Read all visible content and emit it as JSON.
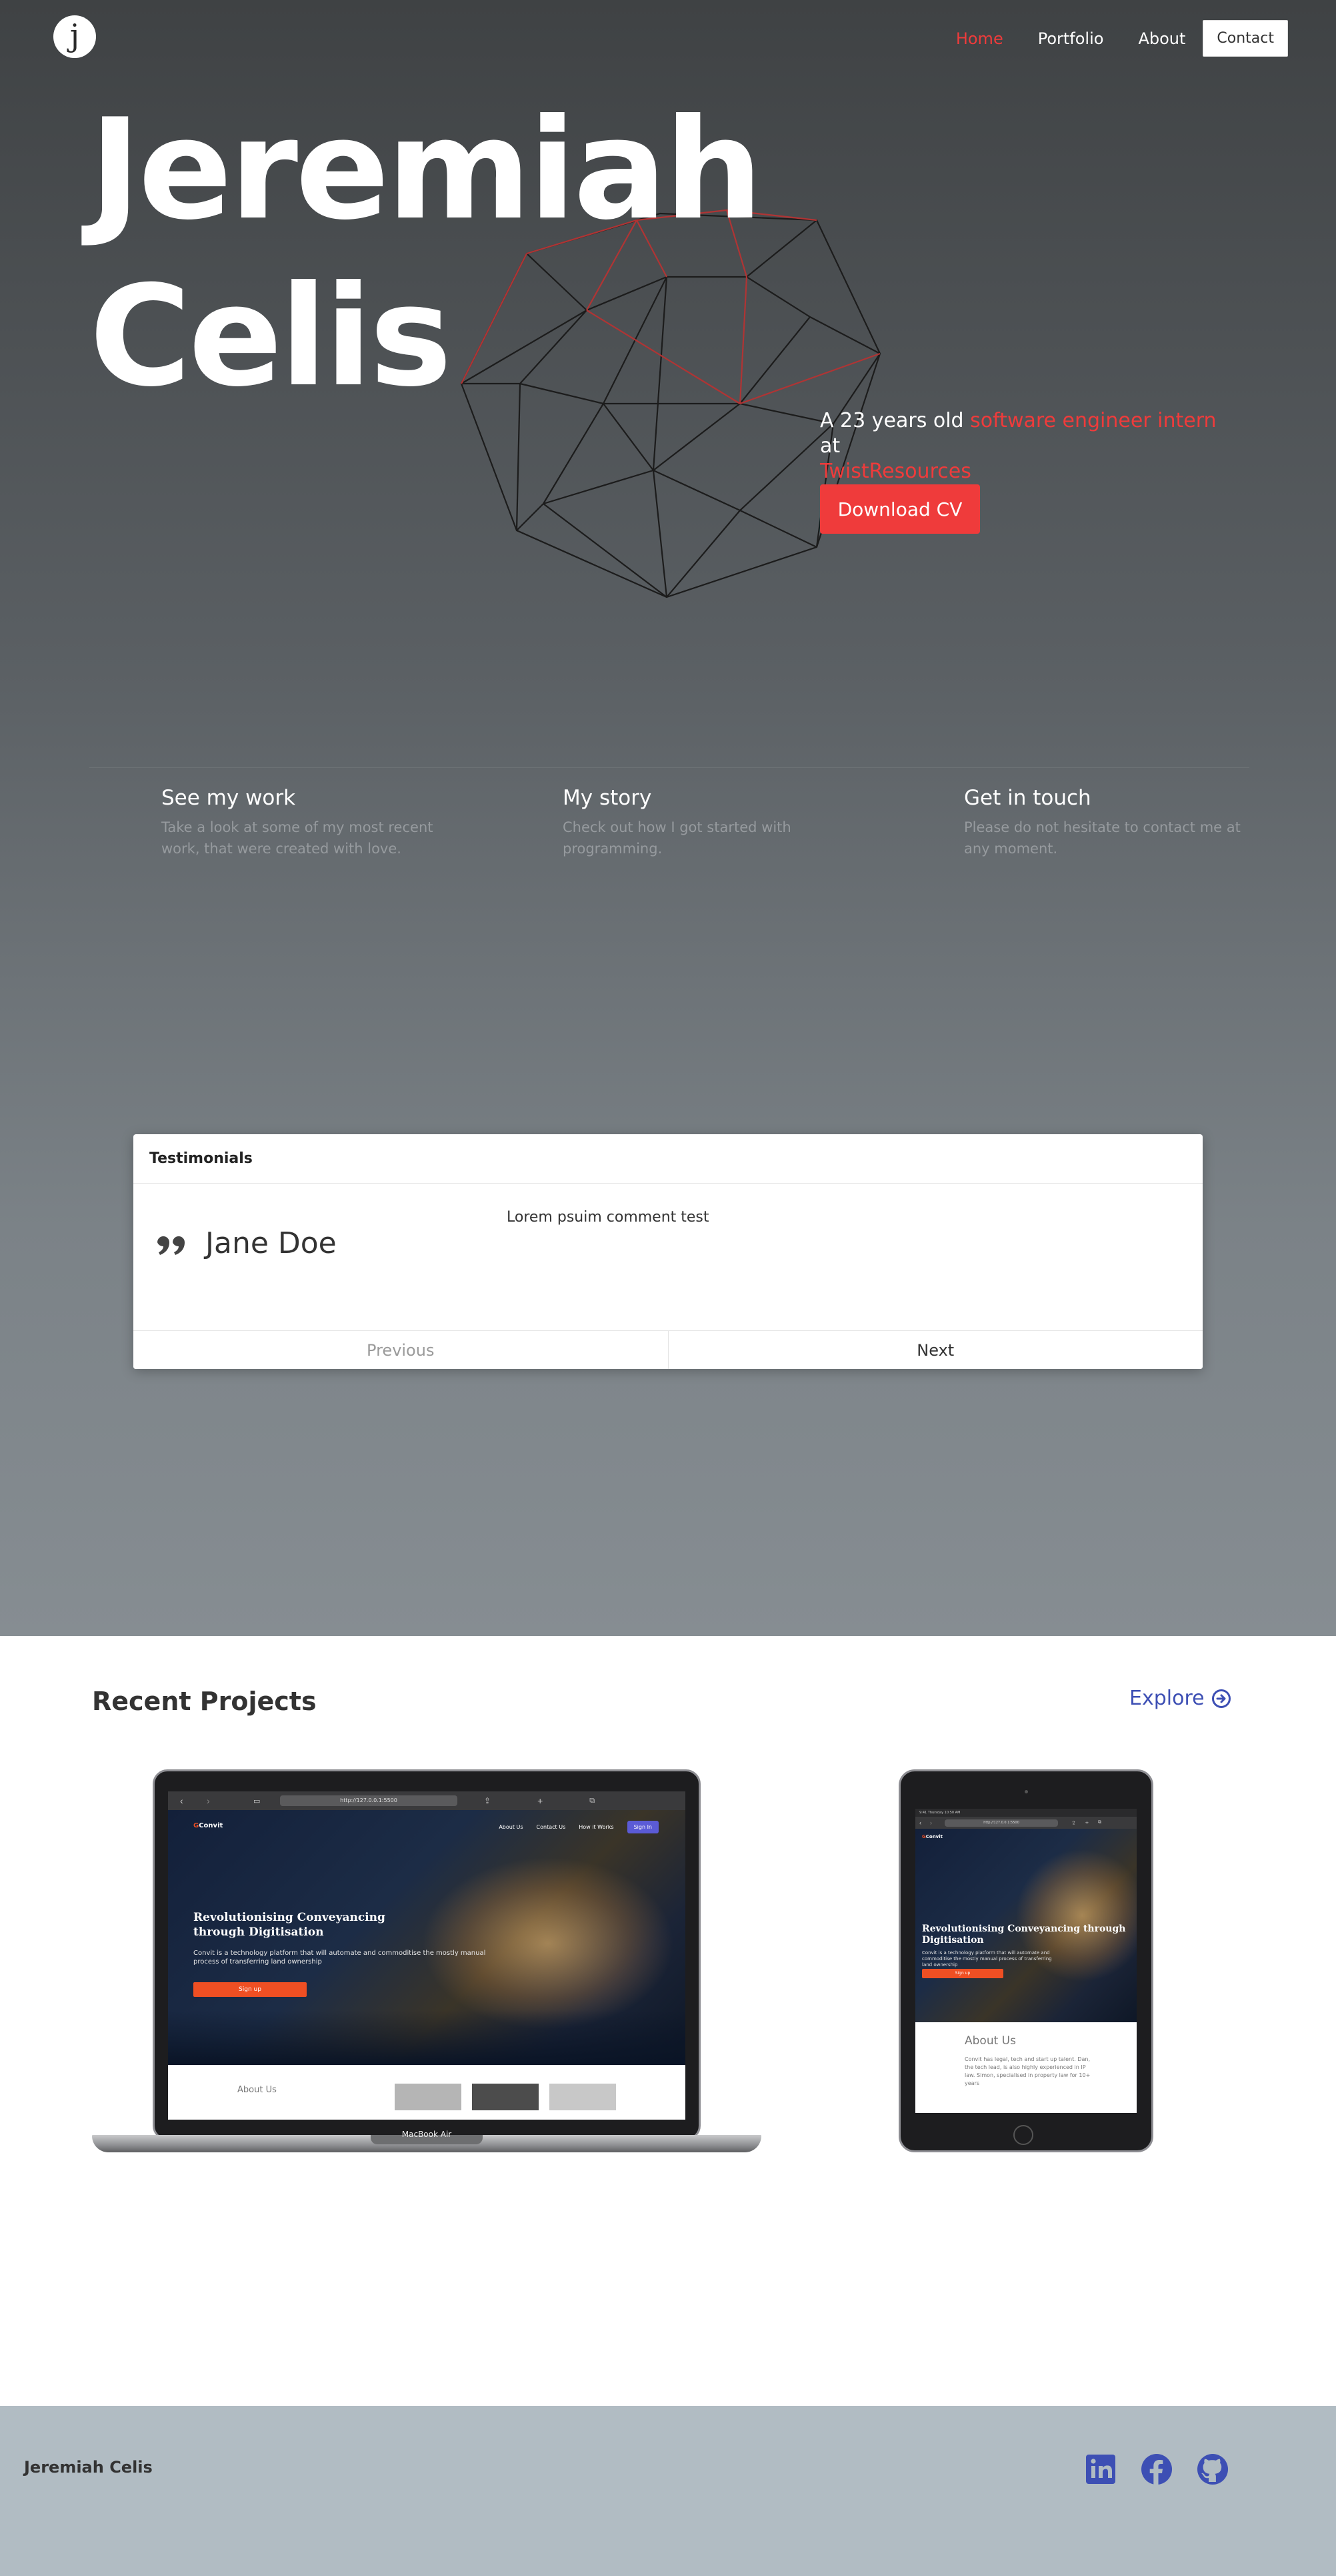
{
  "brand": {
    "logo_letter": "j"
  },
  "nav": {
    "home": "Home",
    "portfolio": "Portfolio",
    "about": "About",
    "contact": "Contact"
  },
  "hero": {
    "name_line1": "Jeremiah",
    "name_line2": "Celis",
    "tagline_prefix": "A 23 years old",
    "tagline_role": "software engineer intern",
    "tagline_at": "at",
    "tagline_company": "TwistResources",
    "cv_button": "Download CV"
  },
  "features": [
    {
      "title": "See my work",
      "text": "Take a look at some of my most recent work, that were created with love."
    },
    {
      "title": "My story",
      "text": "Check out how I got started with programming."
    },
    {
      "title": "Get in touch",
      "text": "Please do not hesitate to contact me at any moment."
    }
  ],
  "testimonials": {
    "header": "Testimonials",
    "name": "Jane Doe",
    "comment": "Lorem psuim comment test",
    "previous": "Previous",
    "next": "Next"
  },
  "projects": {
    "title": "Recent Projects",
    "explore": "Explore",
    "laptop_label": "MacBook Air",
    "laptop_url": "http://127.0.0.1:5500",
    "tablet_url": "http://127.0.0.1:5500",
    "tablet_status": "9:41 Thursday 10:50 AM",
    "site": {
      "logo_mark": "G",
      "logo_text": "Convit",
      "nav_about": "About Us",
      "nav_contact": "Contact Us",
      "nav_how": "How it Works",
      "nav_signin": "Sign In",
      "heading": "Revolutionising Conveyancing through Digitisation",
      "text": "Convit is a technology platform that will automate and commoditise the mostly manual process of transferring land ownership",
      "signup": "Sign up",
      "about": "About Us",
      "about_text": "Convit has legal, tech and start up talent. Dan, the tech lead, is also highly experienced in IP law. Simon, specialised in property law for 10+ years"
    }
  },
  "footer": {
    "name": "Jeremiah Celis"
  },
  "colors": {
    "accent": "#ef3b3b",
    "link": "#3d4fb4",
    "footer_bg": "#b1bcc3"
  },
  "icons": [
    "linkedin-icon",
    "facebook-icon",
    "github-icon",
    "quote-icon",
    "arrow-circle-right-icon"
  ]
}
